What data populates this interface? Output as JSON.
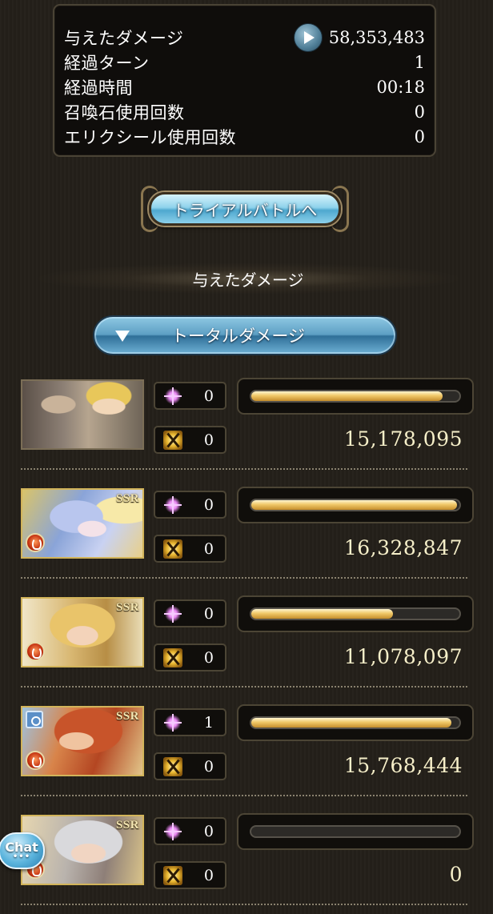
{
  "summary": {
    "rows": [
      {
        "label": "与えたダメージ",
        "value": "58,353,483"
      },
      {
        "label": "経過ターン",
        "value": "1"
      },
      {
        "label": "経過時間",
        "value": "00:18"
      },
      {
        "label": "召喚石使用回数",
        "value": "0"
      },
      {
        "label": "エリクシール使用回数",
        "value": "0"
      }
    ]
  },
  "trial_button": {
    "label": "トライアルバトルへ"
  },
  "section": {
    "title": "与えたダメージ"
  },
  "dropdown": {
    "label": "トータルダメージ"
  },
  "characters": [
    {
      "skill_count": "0",
      "ca_count": "0",
      "damage": "15,178,095",
      "ssr": "",
      "bar_fraction": 0.92
    },
    {
      "skill_count": "0",
      "ca_count": "0",
      "damage": "16,328,847",
      "ssr": "SSR",
      "bar_fraction": 0.99
    },
    {
      "skill_count": "0",
      "ca_count": "0",
      "damage": "11,078,097",
      "ssr": "SSR",
      "bar_fraction": 0.68
    },
    {
      "skill_count": "1",
      "ca_count": "0",
      "damage": "15,768,444",
      "ssr": "SSR",
      "bar_fraction": 0.96
    },
    {
      "skill_count": "0",
      "ca_count": "0",
      "damage": "0",
      "ssr": "SSR",
      "bar_fraction": 0
    }
  ],
  "chat": {
    "label": "Chat",
    "dots": "•••"
  },
  "colors": {
    "bar_gold": "#f0c868",
    "frame_gold": "#d2b45a",
    "button_blue": "#5d9fc4"
  }
}
